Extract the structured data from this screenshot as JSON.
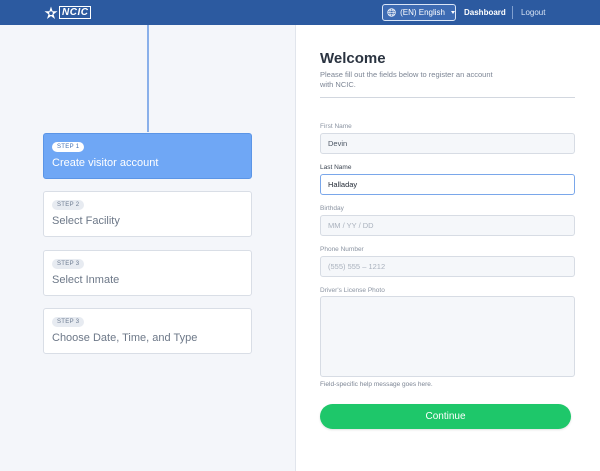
{
  "header": {
    "logo_text": "NCIC",
    "language_label": "(EN) English",
    "nav_dashboard": "Dashboard",
    "nav_logout": "Logout"
  },
  "steps": [
    {
      "badge": "STEP 1",
      "title": "Create visitor account",
      "active": true
    },
    {
      "badge": "STEP 2",
      "title": "Select Facility",
      "active": false
    },
    {
      "badge": "STEP 3",
      "title": "Select Inmate",
      "active": false
    },
    {
      "badge": "STEP 3",
      "title": "Choose Date, Time, and Type",
      "active": false
    }
  ],
  "form": {
    "title": "Welcome",
    "intro": "Please fill out the fields below to register an account with NCIC.",
    "first_name_label": "First Name",
    "first_name_value": "Devin",
    "last_name_label": "Last Name",
    "last_name_value": "Halladay",
    "birthday_label": "Birthday",
    "birthday_placeholder": "MM  /  YY  /  DD",
    "phone_label": "Phone Number",
    "phone_placeholder": "(555)  555 – 1212",
    "license_label": "Driver's License Photo",
    "help_text": "Field-specific help message goes here.",
    "continue_label": "Continue"
  },
  "colors": {
    "header_bg": "#2c5aa0",
    "active_step": "#6fa7f5",
    "continue_button": "#1ec76a"
  },
  "icons": {
    "logo": "star-badge-icon",
    "language": "globe-icon",
    "dropdown": "caret-down-icon"
  }
}
